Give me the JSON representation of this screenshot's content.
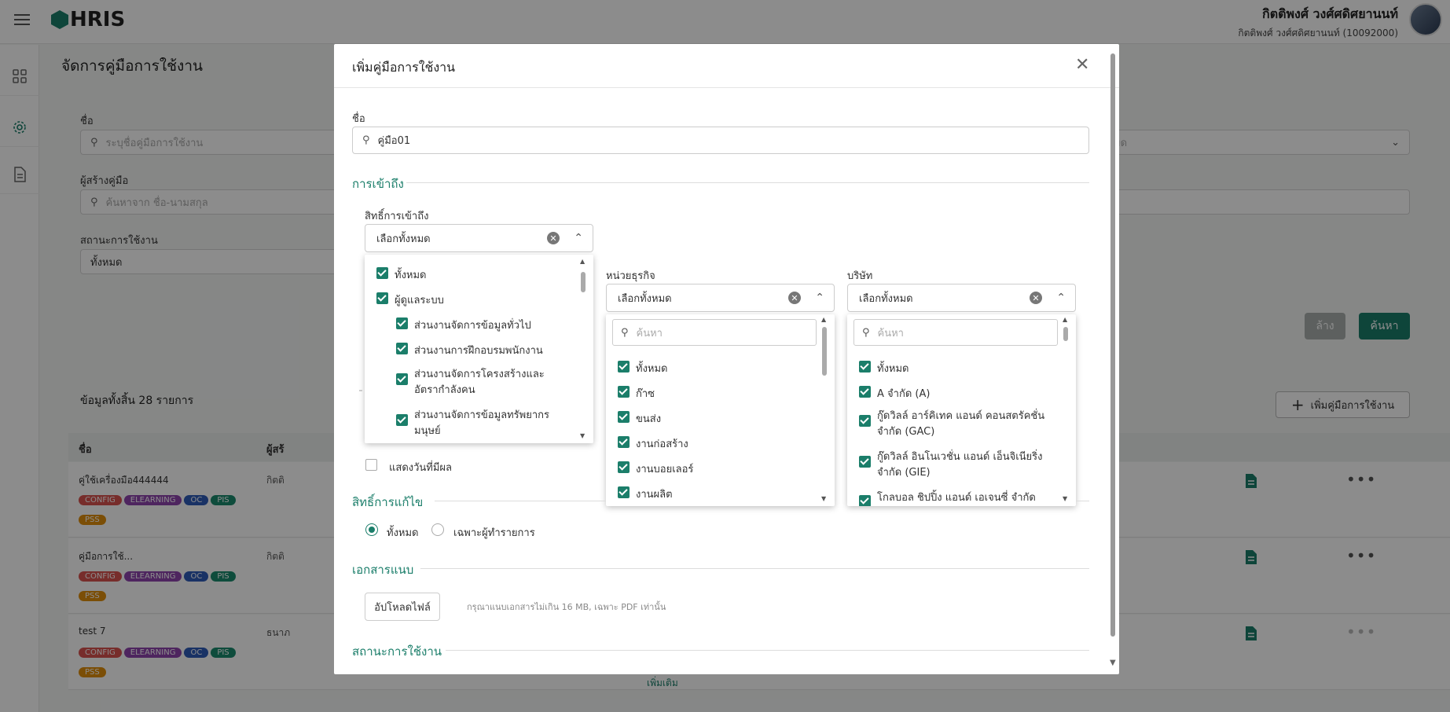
{
  "app": {
    "logo_text": "HRIS",
    "user_name": "กิตติพงศ์ วงศ์ศดิศยานนท์",
    "user_sub": "กิตติพงศ์ วงศ์ศดิศยานนท์ (10092000)"
  },
  "page": {
    "title": "จัดการคู่มือการใช้งาน",
    "filters": {
      "name_label": "ชื่อ",
      "name_placeholder": "ระบุชื่อคู่มือการใช้งาน",
      "creator_label": "ผู้สร้างคู่มือ",
      "creator_placeholder": "ค้นหาจาก ชื่อ-นามสกุล",
      "status_label": "สถานะการใช้งาน",
      "status_value": "ทั้งหมด",
      "right_select_value": "มด"
    },
    "clear_label": "ล้าง",
    "search_label": "ค้นหา",
    "total_text": "ข้อมูลทั้งสิ้น 28 รายการ",
    "add_label": "เพิ่มคู่มือการใช้งาน",
    "table": {
      "headers": [
        "ชื่อ",
        "ผู้สร้"
      ],
      "rows": [
        {
          "name": "คู่ใช้เครื่องมือ444444",
          "by": "กิตติ",
          "tags": [
            "CONFIG",
            "ELEARNING",
            "OC",
            "PIS",
            "PSS"
          ]
        },
        {
          "name": "คู่มือการใช้...",
          "by": "กิตติ",
          "tags": [
            "CONFIG",
            "ELEARNING",
            "OC",
            "PIS",
            "PSS"
          ]
        },
        {
          "name": "test 7",
          "by": "ธนาภ",
          "tags": [
            "CONFIG",
            "ELEARNING",
            "OC",
            "PIS",
            "PSS"
          ]
        }
      ],
      "more_label": "เพิ่มเติม"
    }
  },
  "modal": {
    "title": "เพิ่มคู่มือการใช้งาน",
    "name_label": "ชื่อ",
    "name_value": "คู่มือ01",
    "access_section": "การเข้าถึง",
    "access_right_label": "สิทธิ์การเข้าถึง",
    "access_right_value": "เลือกทั้งหมด",
    "access_options": [
      {
        "label": "ทั้งหมด",
        "indent": 0
      },
      {
        "label": "ผู้ดูแลระบบ",
        "indent": 0
      },
      {
        "label": "ส่วนงานจัดการข้อมูลทั่วไป",
        "indent": 1
      },
      {
        "label": "ส่วนงานการฝึกอบรมพนักงาน",
        "indent": 1
      },
      {
        "label": "ส่วนงานจัดการโครงสร้างและอัตรากำลังคน",
        "indent": 1
      },
      {
        "label": "ส่วนงานจัดการข้อมูลทรัพยากรมนุษย์",
        "indent": 1
      }
    ],
    "bu_label": "หน่วยธุรกิจ",
    "bu_value": "เลือกทั้งหมด",
    "bu_search_placeholder": "ค้นหา",
    "bu_options": [
      "ทั้งหมด",
      "ก๊าซ",
      "ขนส่ง",
      "งานก่อสร้าง",
      "งานบอยเลอร์",
      "งานผลิต"
    ],
    "company_label": "บริษัท",
    "company_value": "เลือกทั้งหมด",
    "company_search_placeholder": "ค้นหา",
    "company_options": [
      "ทั้งหมด",
      "A จำกัด (A)",
      "กู๊ดวิลล์ อาร์คิเทค แอนด์ คอนสตรัคชั่น จำกัด (GAC)",
      "กู๊ดวิลล์ อินโนเวชั่น แอนด์ เอ็นจิเนียริ่ง จำกัด (GIE)",
      "โกลบอล ชิปปิ้ง แอนด์ เอเจนซี่ จำกัด"
    ],
    "show_date_label": "แสดงวันที่มีผล",
    "edit_section": "สิทธิ์การแก้ไข",
    "edit_all": "ทั้งหมด",
    "edit_owner": "เฉพาะผู้ทำรายการ",
    "attach_section": "เอกสารแนบ",
    "upload_label": "อัปโหลดไฟล์",
    "upload_hint": "กรุณาแนบเอกสารไม่เกิน 16 MB, เฉพาะ PDF เท่านั้น",
    "status_section": "สถานะการใช้งาน"
  },
  "colors": {
    "accent": "#1b7e6a",
    "config": "#d9534f",
    "elearning": "#8e44ad",
    "oc": "#2e5bb8",
    "pis": "#1b8a6e",
    "pss": "#e08e0b"
  }
}
